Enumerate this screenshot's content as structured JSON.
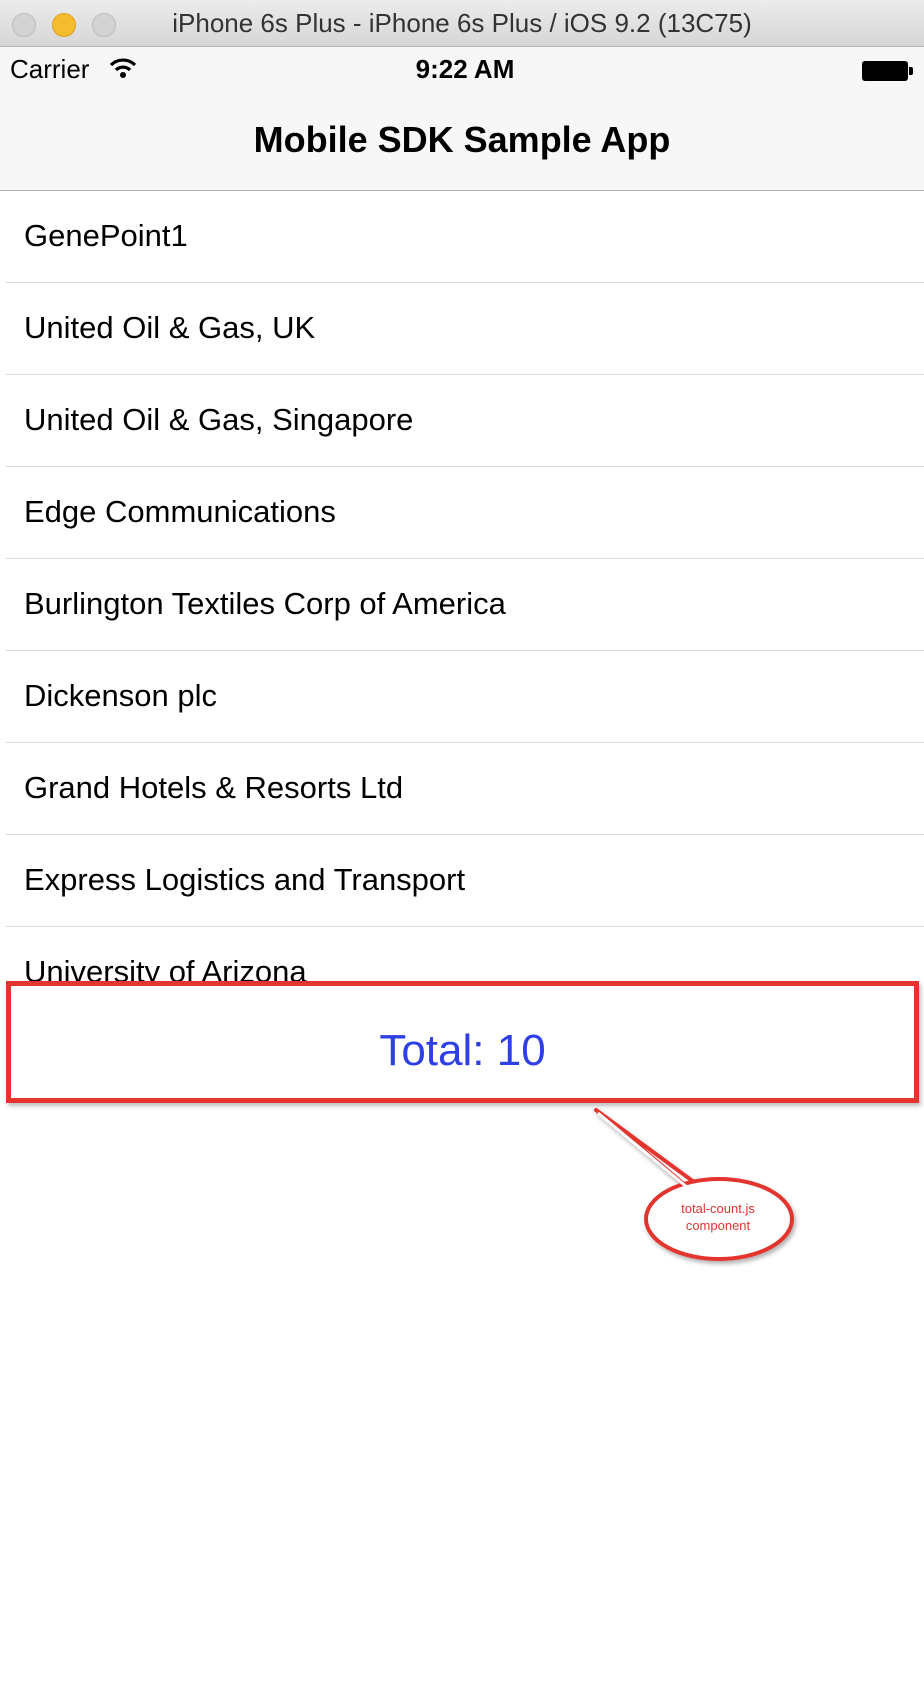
{
  "window": {
    "title": "iPhone 6s Plus - iPhone 6s Plus / iOS 9.2 (13C75)"
  },
  "status_bar": {
    "carrier": "Carrier",
    "time": "9:22 AM"
  },
  "nav": {
    "title": "Mobile SDK Sample App"
  },
  "accounts": [
    "GenePoint1",
    "United Oil & Gas, UK",
    "United Oil & Gas, Singapore",
    "Edge Communications",
    "Burlington Textiles Corp of America",
    "Dickenson plc",
    "Grand Hotels & Resorts Ltd",
    "Express Logistics and Transport",
    "University of Arizona"
  ],
  "total": {
    "text": "Total: 10"
  },
  "annotation": {
    "line1": "total-count.js",
    "line2": "component"
  },
  "colors": {
    "accent_blue": "#2e3fe6",
    "annotation_red": "#e3342f"
  }
}
